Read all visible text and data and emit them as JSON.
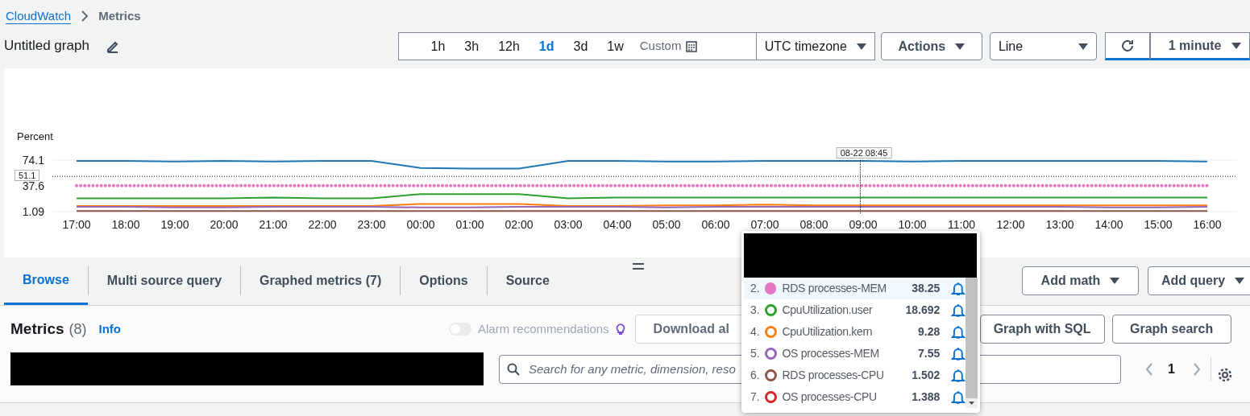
{
  "breadcrumb": {
    "link": "CloudWatch",
    "current": "Metrics"
  },
  "graph_title": "Untitled graph",
  "time_ranges": [
    {
      "label": "1h",
      "selected": false
    },
    {
      "label": "3h",
      "selected": false
    },
    {
      "label": "12h",
      "selected": false
    },
    {
      "label": "1d",
      "selected": true
    },
    {
      "label": "3d",
      "selected": false
    },
    {
      "label": "1w",
      "selected": false
    }
  ],
  "custom_label": "Custom",
  "timezone": "UTC timezone",
  "actions_label": "Actions",
  "chart_type": "Line",
  "refresh_interval": "1 minute",
  "chart": {
    "crosshair_time": "08-22 08:45",
    "chart_data": {
      "type": "line",
      "ylabel": "Percent",
      "yticks": [
        1.09,
        37.6,
        74.1
      ],
      "ylim": [
        1.09,
        74.1
      ],
      "ref_lines": [
        {
          "axis": "y",
          "value": 51.1,
          "label": "51.1"
        }
      ],
      "categories": [
        "17:00",
        "18:00",
        "19:00",
        "20:00",
        "21:00",
        "22:00",
        "23:00",
        "00:00",
        "01:00",
        "02:00",
        "03:00",
        "04:00",
        "05:00",
        "06:00",
        "07:00",
        "08:00",
        "09:00",
        "10:00",
        "11:00",
        "12:00",
        "13:00",
        "14:00",
        "15:00",
        "16:00"
      ],
      "series": [
        {
          "color": "#1f77b4",
          "values": [
            73,
            73,
            72,
            73,
            72,
            73,
            73,
            63,
            62,
            62,
            73,
            73,
            72,
            72,
            73,
            73,
            73,
            72,
            73,
            73,
            73,
            73,
            73,
            72
          ]
        },
        {
          "color": "#e377c2",
          "line_style": "dotted",
          "values": [
            38,
            38,
            38,
            38,
            38,
            38,
            38,
            38,
            38,
            38,
            38,
            38,
            38,
            38,
            38,
            38,
            38,
            38,
            38,
            38,
            38,
            38,
            38,
            38
          ]
        },
        {
          "color": "#2ca02c",
          "values": [
            20,
            20,
            20,
            20,
            21,
            20,
            20,
            26,
            26,
            26,
            20,
            21,
            21,
            21,
            21,
            21,
            21,
            21,
            21,
            21,
            21,
            21,
            21,
            21
          ]
        },
        {
          "color": "#ff7f0e",
          "values": [
            9,
            9,
            9,
            9,
            9,
            9,
            9,
            12,
            12,
            12,
            9,
            9,
            10,
            10,
            11,
            10,
            10,
            10,
            10,
            10,
            10,
            10,
            10,
            10
          ]
        },
        {
          "color": "#9467bd",
          "values": [
            8,
            8,
            7,
            7,
            8,
            8,
            8,
            7,
            7,
            8,
            8,
            8,
            7,
            8,
            8,
            8,
            8,
            8,
            8,
            8,
            8,
            7,
            7,
            8
          ]
        },
        {
          "color": "#8c564b",
          "values": [
            2,
            2,
            2,
            2,
            2,
            2,
            2,
            2,
            2,
            2,
            2,
            2,
            2,
            2,
            2,
            2,
            2,
            2,
            2,
            2,
            2,
            2,
            2,
            2
          ]
        }
      ]
    }
  },
  "tabs": [
    {
      "label": "Browse",
      "selected": true
    },
    {
      "label": "Multi source query",
      "selected": false
    },
    {
      "label": "Graphed metrics (7)",
      "selected": false
    },
    {
      "label": "Options",
      "selected": false
    },
    {
      "label": "Source",
      "selected": false
    }
  ],
  "add_math_label": "Add math",
  "add_query_label": "Add query",
  "metrics_panel": {
    "title": "Metrics",
    "count": "(8)",
    "info": "Info",
    "alarm_recommendations": {
      "label": "Alarm recommendations",
      "on": false
    },
    "download_label": "Download al",
    "graph_sql_label": "Graph with SQL",
    "graph_search_label": "Graph search",
    "search": {
      "placeholder": "Search for any metric, dimension, reso"
    },
    "page": "1"
  },
  "legend_popup": {
    "rows": [
      {
        "index": "2.",
        "name": "RDS processes-MEM",
        "value": "38.25",
        "color": "#e377c2",
        "kind": "filled",
        "selected": true
      },
      {
        "index": "3.",
        "name": "CpuUtilization.user",
        "value": "18.692",
        "color": "#2ca02c",
        "kind": "ring",
        "selected": false
      },
      {
        "index": "4.",
        "name": "CpuUtilization.kern",
        "value": "9.28",
        "color": "#ff7f0e",
        "kind": "ring",
        "selected": false
      },
      {
        "index": "5.",
        "name": "OS processes-MEM",
        "value": "7.55",
        "color": "#9467bd",
        "kind": "ring",
        "selected": false
      },
      {
        "index": "6.",
        "name": "RDS processes-CPU",
        "value": "1.502",
        "color": "#8c564b",
        "kind": "ring",
        "selected": false
      },
      {
        "index": "7.",
        "name": "OS processes-CPU",
        "value": "1.388",
        "color": "#d62728",
        "kind": "ring",
        "selected": false
      }
    ]
  }
}
